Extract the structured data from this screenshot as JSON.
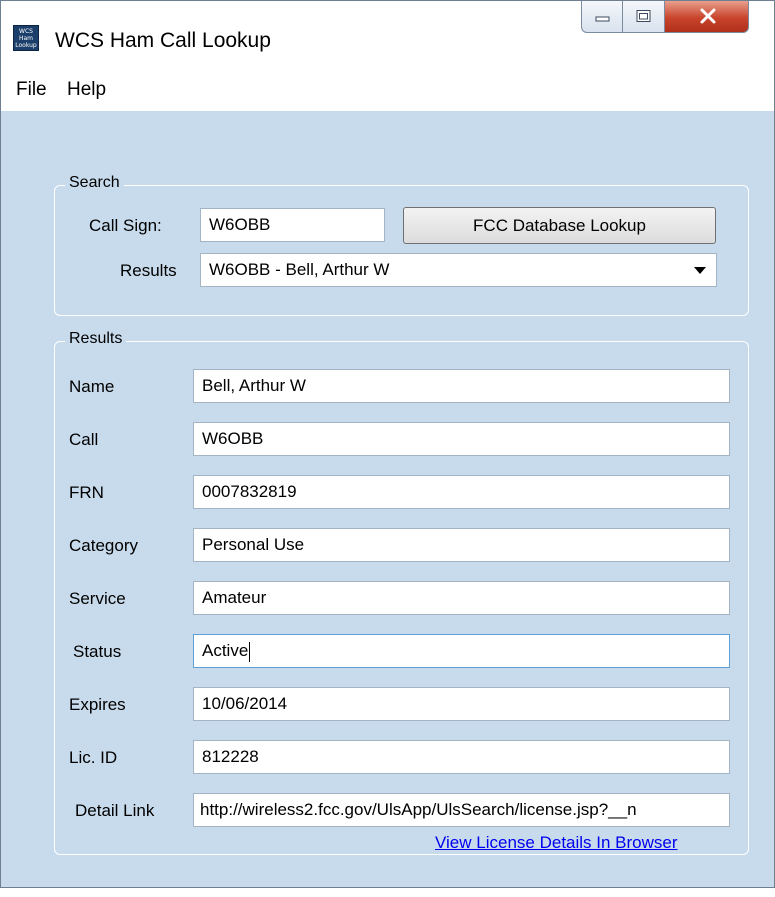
{
  "window": {
    "title": "WCS Ham Call Lookup",
    "app_icon_text": "WCS Ham Lookup"
  },
  "window_controls": {
    "minimize": "minimize",
    "maximize": "maximize",
    "close": "close"
  },
  "menu": {
    "items": [
      "File",
      "Help"
    ]
  },
  "search": {
    "legend": "Search",
    "call_sign_label": "Call Sign:",
    "call_sign_value": "W6OBB",
    "lookup_button": "FCC Database Lookup",
    "results_label": "Results",
    "results_selected": "W6OBB - Bell, Arthur W"
  },
  "results": {
    "legend": "Results",
    "fields": [
      {
        "label": "Name",
        "value": "Bell, Arthur W"
      },
      {
        "label": "Call",
        "value": "W6OBB"
      },
      {
        "label": "FRN",
        "value": "0007832819"
      },
      {
        "label": "Category",
        "value": "Personal Use"
      },
      {
        "label": "Service",
        "value": "Amateur"
      },
      {
        "label": "Status",
        "value": "Active"
      },
      {
        "label": "Expires",
        "value": "10/06/2014"
      },
      {
        "label": "Lic. ID",
        "value": "812228"
      },
      {
        "label": "Detail Link",
        "value": "http://wireless2.fcc.gov/UlsApp/UlsSearch/license.jsp?__n"
      }
    ],
    "browser_link": "View License Details In Browser"
  }
}
